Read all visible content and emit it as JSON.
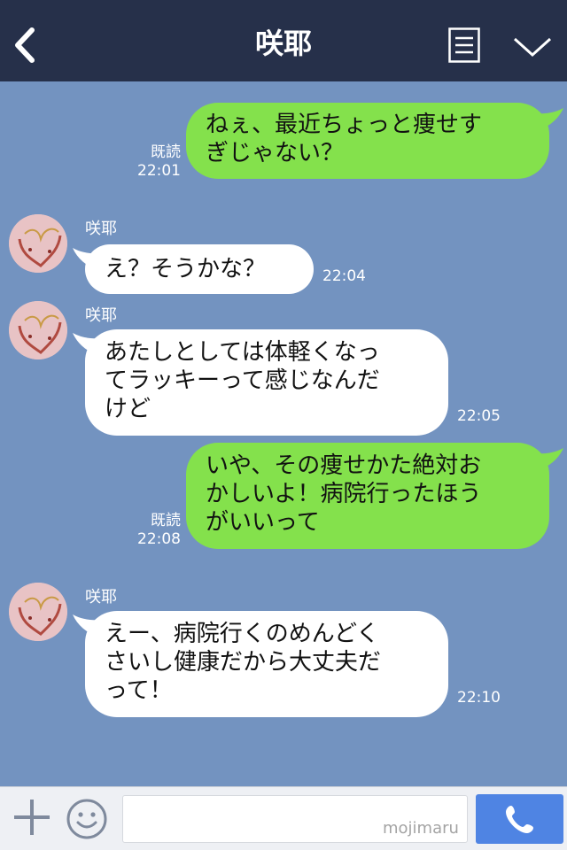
{
  "header": {
    "title": "咲耶",
    "back_icon": "chevron-left-icon",
    "menu_icon": "menu-icon",
    "collapse_icon": "chevron-down-icon",
    "bg_color": "#26304a"
  },
  "chat": {
    "bg_color": "#7393c0",
    "messages": [
      {
        "side": "sent",
        "lines": [
          "ねぇ、最近ちょっと痩せす",
          "ぎじゃない？"
        ],
        "read": "既読",
        "time": "22:01"
      },
      {
        "side": "received",
        "sender": "咲耶",
        "lines": [
          "え？そうかな？"
        ],
        "time": "22:04"
      },
      {
        "side": "received",
        "sender": "咲耶",
        "lines": [
          "あたしとしては体軽くなっ",
          "てラッキーって感じなんだ",
          "けど"
        ],
        "time": "22:05"
      },
      {
        "side": "sent",
        "lines": [
          "いや、その痩せかた絶対お",
          "かしいよ！病院行ったほう",
          "がいいって"
        ],
        "read": "既読",
        "time": "22:08"
      },
      {
        "side": "received",
        "sender": "咲耶",
        "lines": [
          "えー、病院行くのめんどく",
          "さいし健康だから大丈夫だ",
          "って！"
        ],
        "time": "22:10"
      }
    ],
    "sent_bubble_color": "#84e14c",
    "received_bubble_color": "#ffffff"
  },
  "input_bar": {
    "plus_icon": "plus-icon",
    "emoji_icon": "smiley-icon",
    "input_value": "",
    "watermark": "mojimaru",
    "call_icon": "phone-icon",
    "call_button_color": "#4f84e3"
  }
}
